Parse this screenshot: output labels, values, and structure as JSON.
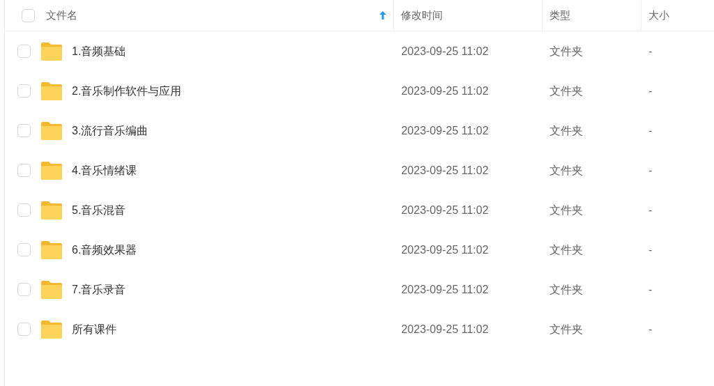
{
  "header": {
    "select_all_checked": false,
    "columns": [
      {
        "label": "文件名",
        "sorted": true
      },
      {
        "label": "修改时间",
        "sorted": false
      },
      {
        "label": "类型",
        "sorted": false
      },
      {
        "label": "大小",
        "sorted": false
      }
    ]
  },
  "rows": [
    {
      "name": "1.音频基础",
      "modified": "2023-09-25 11:02",
      "type": "文件夹",
      "size": "-",
      "checked": false
    },
    {
      "name": "2.音乐制作软件与应用",
      "modified": "2023-09-25 11:02",
      "type": "文件夹",
      "size": "-",
      "checked": false
    },
    {
      "name": "3.流行音乐编曲",
      "modified": "2023-09-25 11:02",
      "type": "文件夹",
      "size": "-",
      "checked": false
    },
    {
      "name": "4.音乐情绪课",
      "modified": "2023-09-25 11:02",
      "type": "文件夹",
      "size": "-",
      "checked": false
    },
    {
      "name": "5.音乐混音",
      "modified": "2023-09-25 11:02",
      "type": "文件夹",
      "size": "-",
      "checked": false
    },
    {
      "name": "6.音频效果器",
      "modified": "2023-09-25 11:02",
      "type": "文件夹",
      "size": "-",
      "checked": false
    },
    {
      "name": "7.音乐录音",
      "modified": "2023-09-25 11:02",
      "type": "文件夹",
      "size": "-",
      "checked": false
    },
    {
      "name": "所有课件",
      "modified": "2023-09-25 11:02",
      "type": "文件夹",
      "size": "-",
      "checked": false
    }
  ]
}
